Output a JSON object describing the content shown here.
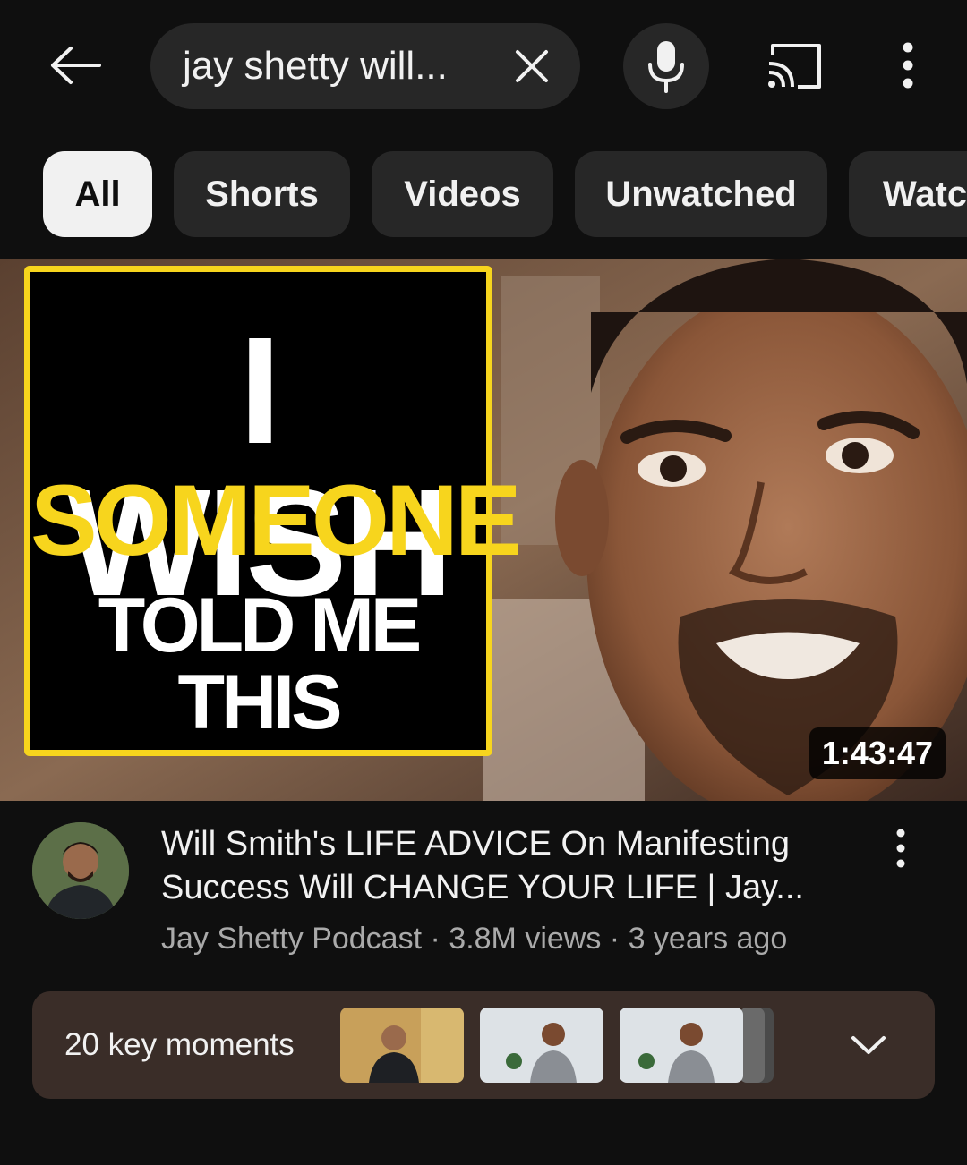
{
  "search": {
    "query": "jay shetty will..."
  },
  "icons": {
    "back": "arrow-left-icon",
    "clear": "close-icon",
    "mic": "microphone-icon",
    "cast": "cast-icon",
    "more": "more-vertical-icon",
    "expand": "chevron-down-icon"
  },
  "filters": {
    "chips": [
      {
        "label": "All",
        "selected": true
      },
      {
        "label": "Shorts",
        "selected": false
      },
      {
        "label": "Videos",
        "selected": false
      },
      {
        "label": "Unwatched",
        "selected": false
      },
      {
        "label": "Watc",
        "selected": false
      }
    ]
  },
  "video": {
    "thumbnail_text": {
      "line1": "I WISH",
      "line2": "SOMEONE",
      "line3": "TOLD ME THIS"
    },
    "duration": "1:43:47",
    "title_line1": "Will Smith's LIFE ADVICE On Manifesting",
    "title_line2": "Success Will CHANGE YOUR LIFE  | Jay...",
    "channel": "Jay Shetty Podcast",
    "views": "3.8M views",
    "age": "3 years ago",
    "separator": "·"
  },
  "key_moments": {
    "label": "20 key moments"
  },
  "colors": {
    "background": "#0f0f0f",
    "chip_bg": "#272727",
    "chip_active_bg": "#f1f1f1",
    "overlay_yellow": "#f7d51d",
    "meta_text": "#aaaaaa",
    "key_moments_bg": "#3a2d28"
  }
}
